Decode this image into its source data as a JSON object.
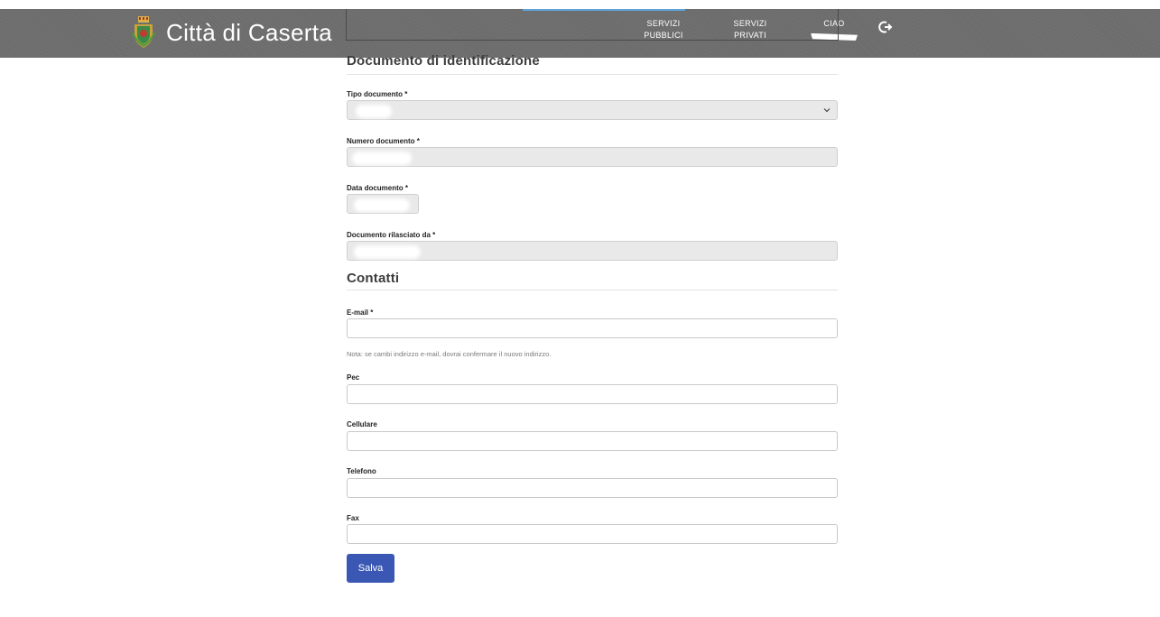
{
  "header": {
    "brand_name": "Città di Caserta",
    "nav": {
      "servizi_pubblici_line1": "SERVIZI",
      "servizi_pubblici_line2": "PUBBLICI",
      "servizi_privati_line1": "SERVIZI",
      "servizi_privati_line2": "PRIVATI",
      "greeting": "CIAO"
    },
    "icons": {
      "crest": "coat-of-arms-icon",
      "logout": "logout-icon"
    }
  },
  "form": {
    "document_section": {
      "title": "Documento di identificazione",
      "tipo_documento_label": "Tipo documento *",
      "numero_documento_label": "Numero documento *",
      "data_documento_label": "Data documento *",
      "rilasciato_da_label": "Documento rilasciato da *"
    },
    "contacts_section": {
      "title": "Contatti",
      "email_label": "E-mail *",
      "email_note": "Nota: se cambi indirizzo e-mail, dovrai confermare il nuovo indirizzo.",
      "pec_label": "Pec",
      "cellulare_label": "Cellulare",
      "telefono_label": "Telefono",
      "fax_label": "Fax"
    },
    "submit_label": "Salva"
  },
  "colors": {
    "header_bg": "#6c6c6c",
    "primary_button": "#3a58b3",
    "readonly_field": "#e9e9e9"
  }
}
